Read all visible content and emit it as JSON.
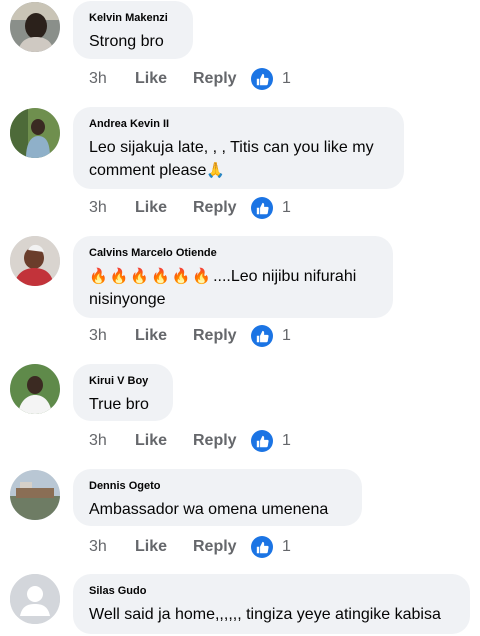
{
  "comments": [
    {
      "author": "Kelvin Makenzi",
      "text": "Strong bro",
      "time": "3h",
      "like_label": "Like",
      "reply_label": "Reply",
      "reactions": "1"
    },
    {
      "author": "Andrea Kevin II",
      "text_line1": "Leo sijakuja late, , , Titis can you like my",
      "text_line2": "comment please",
      "emoji": "🙏",
      "time": "3h",
      "like_label": "Like",
      "reply_label": "Reply",
      "reactions": "1"
    },
    {
      "author": "Calvins Marcelo Otiende",
      "fire_emoji": "🔥🔥🔥🔥🔥🔥",
      "text_line1": "....Leo nijibu nifurahi",
      "text_line2": "nisinyonge",
      "time": "3h",
      "like_label": "Like",
      "reply_label": "Reply",
      "reactions": "1"
    },
    {
      "author": "Kirui V Boy",
      "text": "True bro",
      "time": "3h",
      "like_label": "Like",
      "reply_label": "Reply",
      "reactions": "1"
    },
    {
      "author": "Dennis Ogeto",
      "text": "Ambassador wa omena umenena",
      "time": "3h",
      "like_label": "Like",
      "reply_label": "Reply",
      "reactions": "1"
    },
    {
      "author": "Silas Gudo",
      "text": "Well said ja home,,,,,, tingiza yeye atingike kabisa"
    }
  ],
  "colors": {
    "bubble": "#f0f2f5",
    "meta": "#65676b",
    "like_blue": "#1b74e4"
  },
  "icons": {
    "like_reaction": "thumbs-up-icon"
  }
}
